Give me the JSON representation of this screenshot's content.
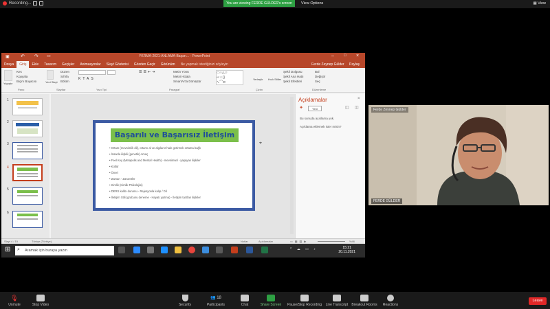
{
  "zoom_top": {
    "recording_label": "Recording...",
    "banner": "You are viewing FERDE GÜLDER's screen",
    "view_options": "View Options",
    "view_button": "View"
  },
  "ppt": {
    "title": "YKRMA-2021-ANLAMA-Başarı... - PowerPoint",
    "menu": [
      "Dosya",
      "Giriş",
      "Ekle",
      "Tasarım",
      "Geçişler",
      "Animasyonlar",
      "Slayt Gösterisi",
      "Gözden Geçir",
      "Görünüm",
      "Ne yapmak istediğinizi söyleyin"
    ],
    "user": "Ferde Zeynep Gülder",
    "share": "Paylaş",
    "ribbon_groups": [
      "Pano",
      "Slaytlar",
      "Yazı Tipi",
      "Paragraf",
      "Çizim",
      "Düzenleme"
    ],
    "ribbon_items": {
      "paste": "Yapıştır",
      "cut": "Kes",
      "copy": "Kopyala",
      "format_painter": "Biçim Boyacısı",
      "new_slide": "Yeni Slayt",
      "layout": "Düzen",
      "reset": "Sıfırla",
      "section": "Bölüm",
      "text_direction": "Metin Yönü",
      "align_text": "Metni Hizala",
      "smartart": "SmartArt'a Dönüştür",
      "arrange": "Yerleştir",
      "quick_styles": "Hızlı Stiller",
      "shape_fill": "Şekil Dolgusu",
      "shape_outline": "Şekil Ana Hattı",
      "shape_effects": "Şekil Efektleri",
      "find": "Bul",
      "replace": "Değiştir",
      "select": "Seç"
    },
    "slide_numbers": [
      "1",
      "2",
      "3",
      "4",
      "5",
      "6"
    ],
    "slide": {
      "title": "Başarılı ve Başarısız İletişim",
      "bullets": [
        "Ortam (mevsimlik dil), ortamı al ve algılanır hale getirmek ortama bağlı",
        "İnsanla ilişkili (genetik) Amaç",
        "Feel Key (Metapolis and Mental Health) - mevsimsel - yaşayan ilişkiler",
        "Kültür",
        "Öneri",
        "Zaman - Zaruretler",
        "Kimlik (Kimlik Psikolojisi)",
        "DERS kalıbı durumu - Rejesyonla kalıp / Dil",
        "İletişim Stili (grubunu deneme - Hayatı yazma) - İletişim tarzları ilişkiler"
      ]
    },
    "comments": {
      "title": "Açıklamalar",
      "new": "Yeni",
      "line1": "Bu sunuda açıklama yok.",
      "line2": "Açıklama eklemek ister misin?"
    },
    "status": {
      "slide_pos": "Slayt 4 / 15",
      "language": "Türkçe (Türkiye)",
      "notes": "Notlar",
      "comments_btn": "Açıklamalar",
      "zoom": "%46"
    }
  },
  "windows_taskbar": {
    "search_placeholder": "Aramak için buraya yazın",
    "time": "15:21",
    "date": "20.11.2021"
  },
  "webcam": {
    "name_top": "Ferde Zeynep Gülder",
    "name_bottom": "FERDE GÜLDER"
  },
  "toolbar": {
    "unmute": "Unmute",
    "stop_video": "Stop Video",
    "security": "Security",
    "participants": "Participants",
    "participants_count": "18",
    "chat": "Chat",
    "share_screen": "Share Screen",
    "record": "Pause/Stop Recording",
    "live_transcript": "Live Transcript",
    "breakout": "Breakout Rooms",
    "reactions": "Reactions",
    "leave": "Leave"
  },
  "colors": {
    "ppt_accent": "#b7472a",
    "slide_border": "#3b5aa3",
    "slide_title_bg": "#7bbf4b",
    "slide_title_text": "#1e4d9a",
    "share_green": "#2ea043",
    "leave_red": "#e02828"
  }
}
